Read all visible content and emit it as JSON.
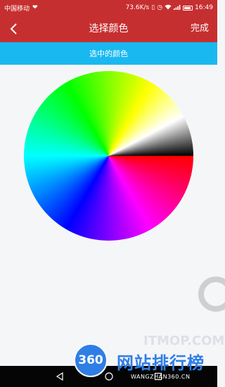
{
  "status_bar": {
    "carrier": "中国移动",
    "network_speed": "73.6K/s",
    "time": "16:49"
  },
  "title_bar": {
    "title": "选择颜色",
    "done_label": "完成",
    "back_icon": "chevron-left-icon"
  },
  "selected_color": {
    "label": "选中的颜色",
    "color": "#19b8f0"
  },
  "colors": {
    "accent": "#c62f2f",
    "selected_bar": "#19b8f0"
  },
  "watermark": {
    "badge": "360",
    "text": "网站排行榜",
    "sub": "WANGZHAN360.CN",
    "faint": "ITMOP.COM"
  }
}
